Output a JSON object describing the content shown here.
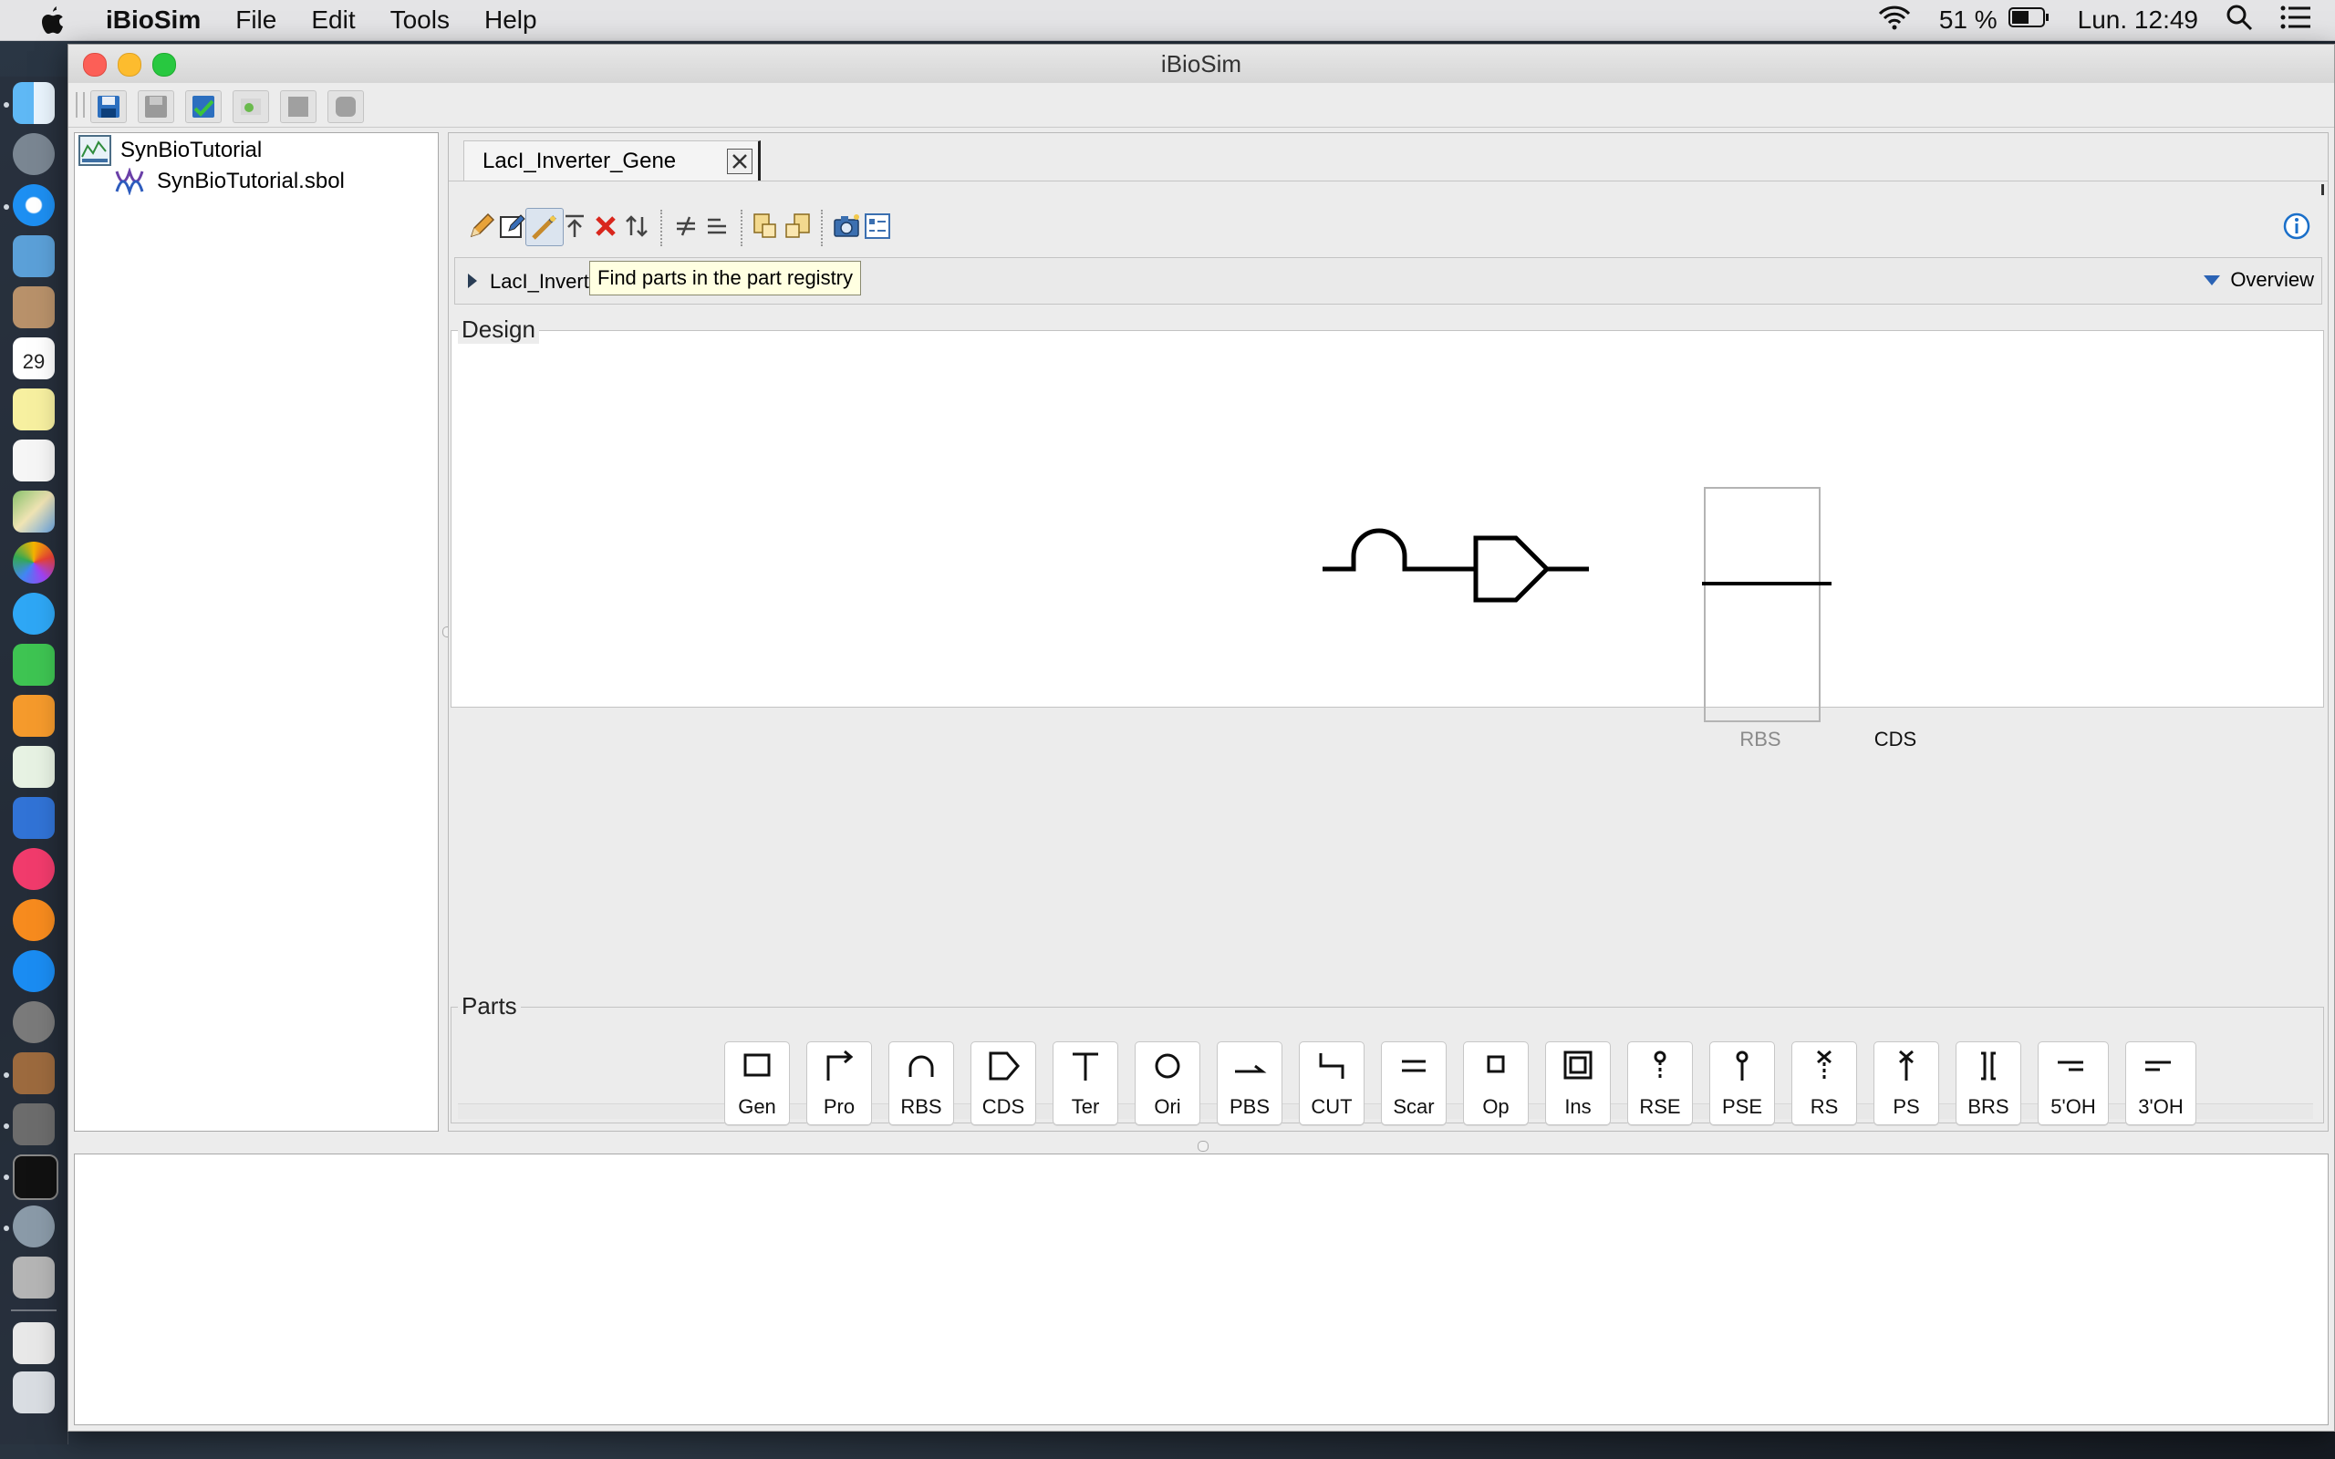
{
  "menubar": {
    "app_name": "iBioSim",
    "menus": [
      "File",
      "Edit",
      "Tools",
      "Help"
    ],
    "battery": "51 %",
    "clock": "Lun. 12:49"
  },
  "window": {
    "title": "iBioSim"
  },
  "tree": {
    "project": "SynBioTutorial",
    "file": "SynBioTutorial.sbol"
  },
  "editor": {
    "tab_label": "LacI_Inverter_Gene",
    "breadcrumb": "LacI_Inverte",
    "tooltip": "Find parts in the part registry",
    "overview_label": "Overview"
  },
  "design": {
    "group_title": "Design",
    "glyphs": [
      "RBS",
      "CDS"
    ]
  },
  "parts": {
    "group_title": "Parts",
    "items": [
      "Gen",
      "Pro",
      "RBS",
      "CDS",
      "Ter",
      "Ori",
      "PBS",
      "CUT",
      "Scar",
      "Op",
      "Ins",
      "RSE",
      "PSE",
      "RS",
      "PS",
      "BRS",
      "5'OH",
      "3'OH"
    ]
  },
  "dock": {
    "calendar_day": "29"
  }
}
